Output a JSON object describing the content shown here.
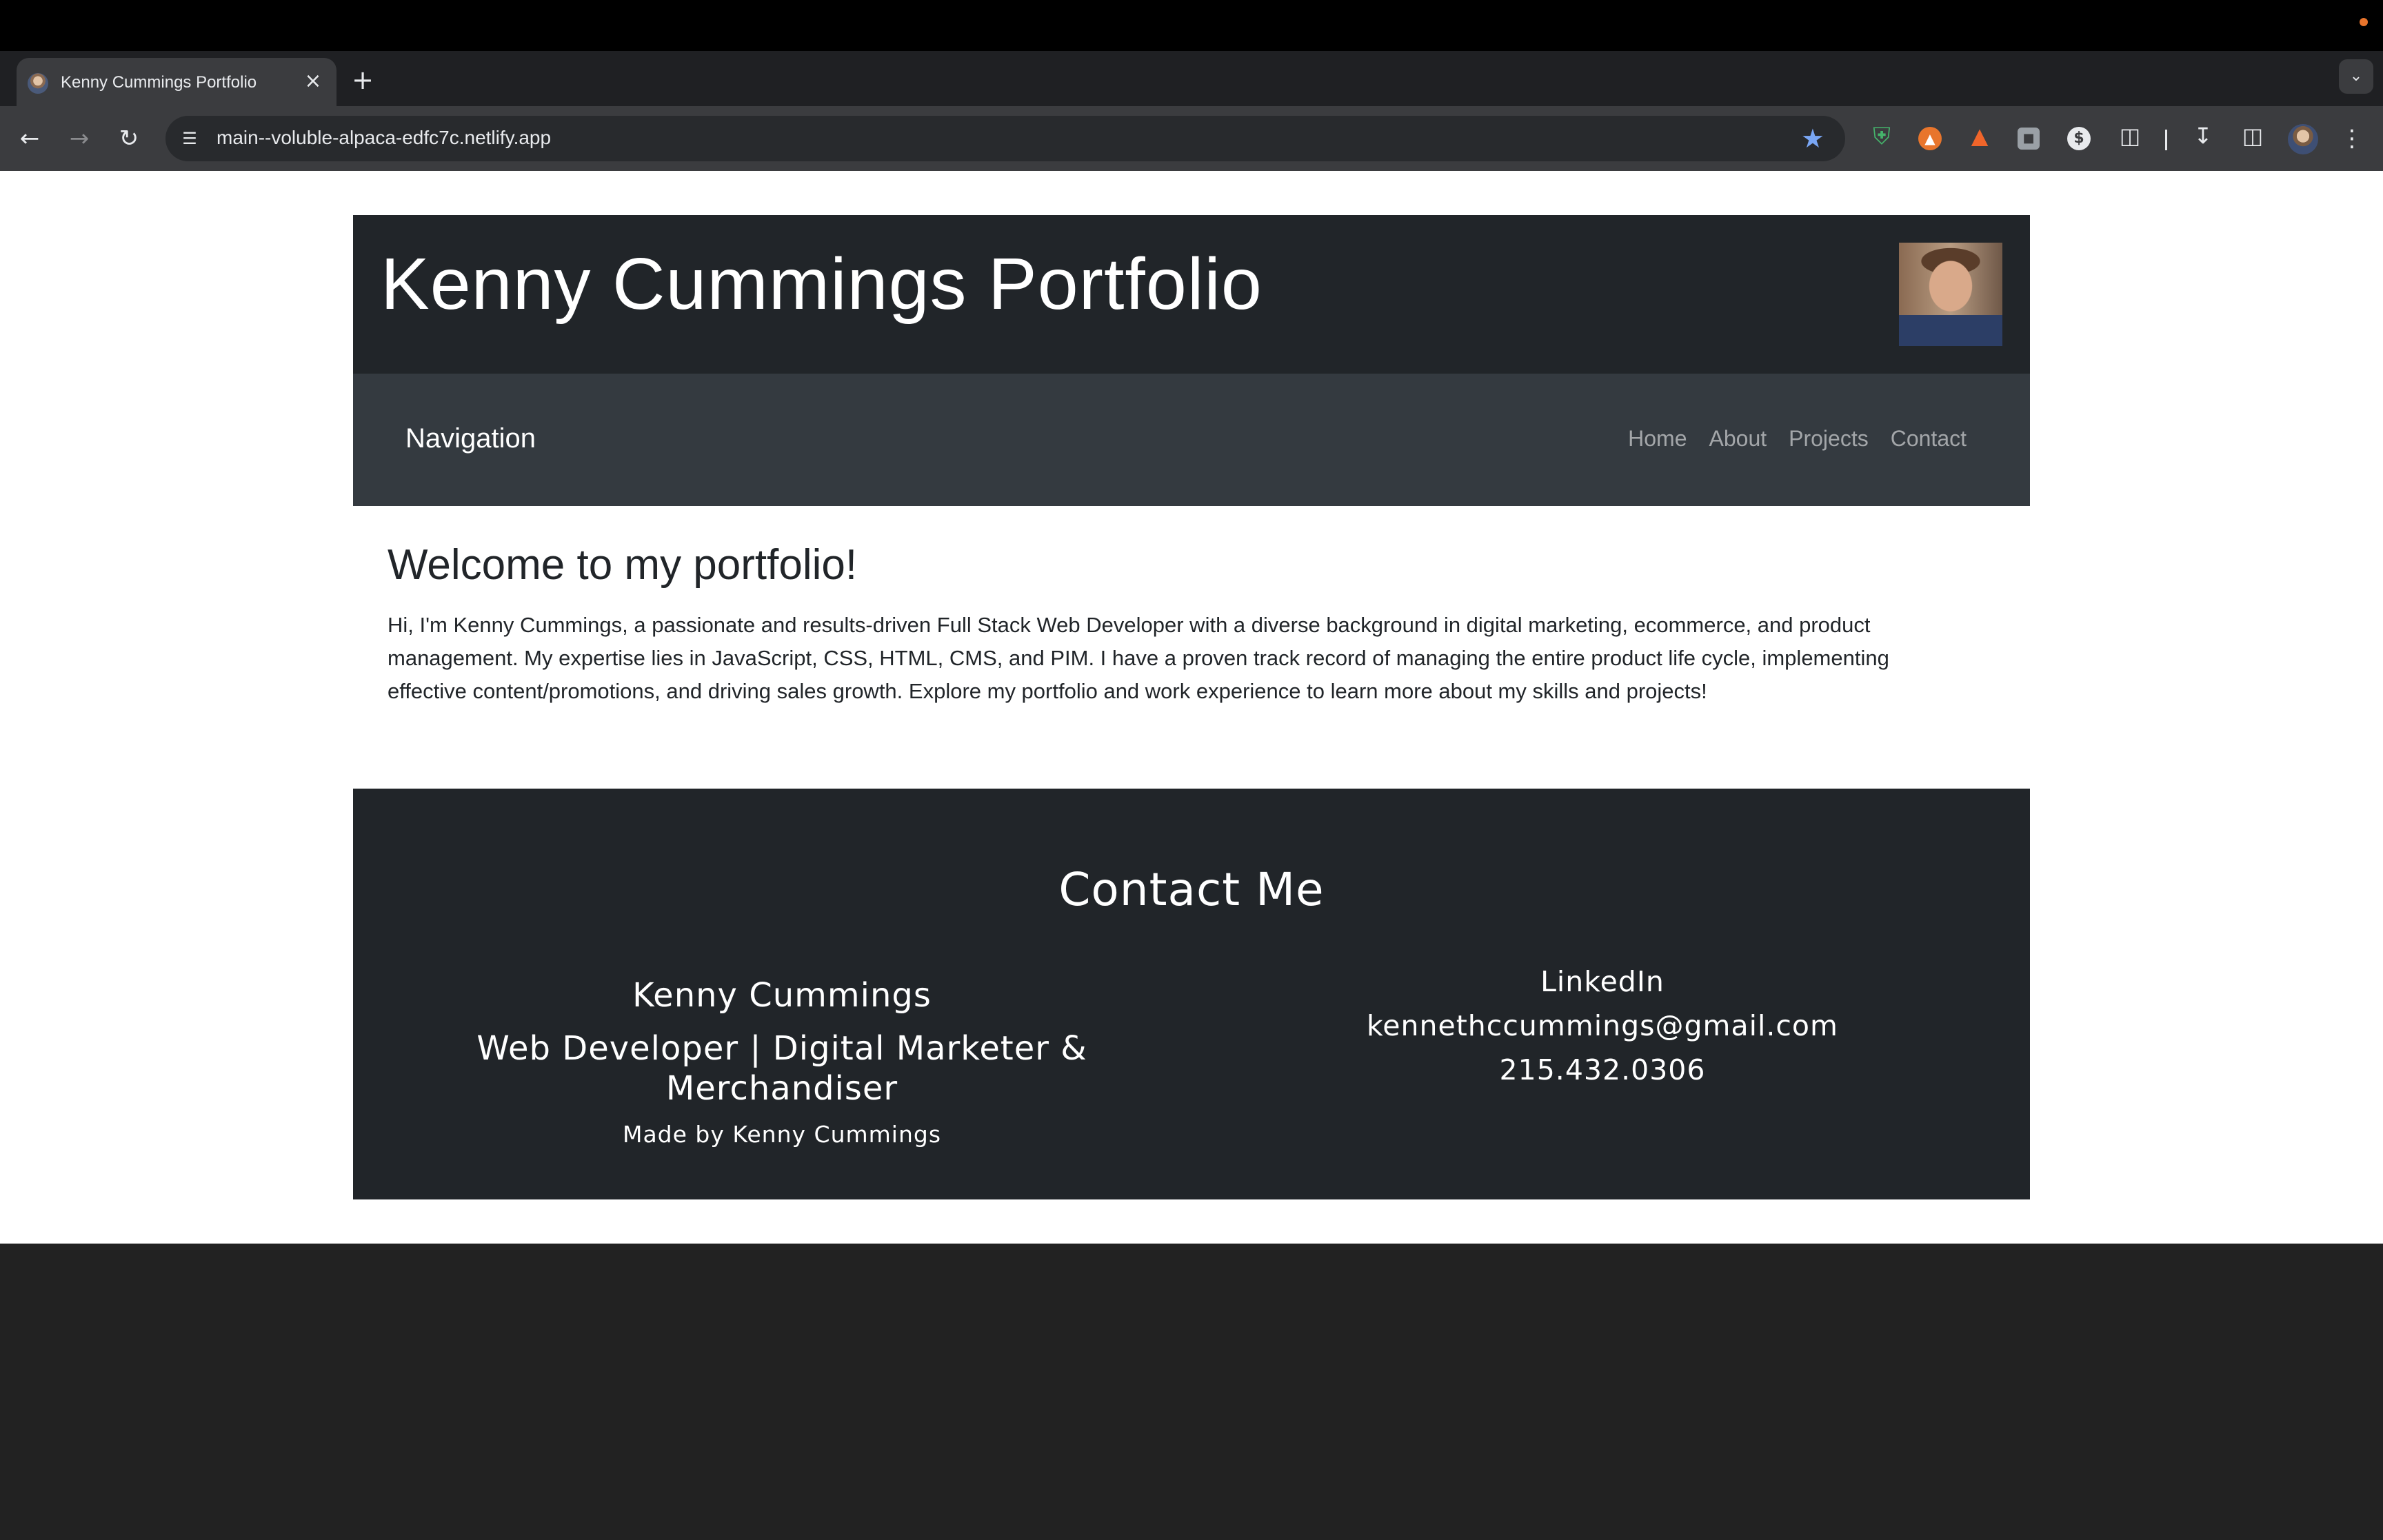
{
  "browser": {
    "tab_title": "Kenny Cummings Portfolio",
    "tab_close": "×",
    "new_tab": "+",
    "url": "main--voluble-alpaca-edfc7c.netlify.app"
  },
  "header": {
    "title": "Kenny Cummings Portfolio"
  },
  "navbar": {
    "brand": "Navigation",
    "links": [
      "Home",
      "About",
      "Projects",
      "Contact"
    ]
  },
  "intro": {
    "heading": "Welcome to my portfolio!",
    "body": "Hi, I'm Kenny Cummings, a passionate and results-driven Full Stack Web Developer with a diverse background in digital marketing, ecommerce, and product management. My expertise lies in JavaScript, CSS, HTML, CMS, and PIM. I have a proven track record of managing the entire product life cycle, implementing effective content/promotions, and driving sales growth. Explore my portfolio and work experience to learn more about my skills and projects!"
  },
  "contact": {
    "heading": "Contact Me",
    "name": "Kenny Cummings",
    "role": "Web Developer | Digital Marketer & Merchandiser",
    "made_by": "Made by Kenny Cummings",
    "linkedin": "LinkedIn",
    "email": "kennethccummings@gmail.com",
    "phone": "215.432.0306"
  },
  "colors": {
    "header_bg": "#212529",
    "navbar_bg": "#343a40",
    "footer_bg": "#212529",
    "page_bg": "#ffffff",
    "accent_star": "#7aa7f5"
  }
}
